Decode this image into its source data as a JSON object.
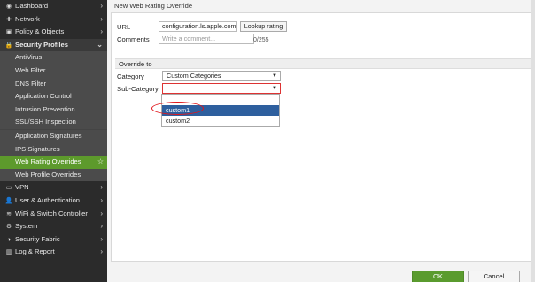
{
  "sidebar": {
    "items": [
      {
        "label": "Dashboard",
        "icon": "dashboard-icon",
        "glyph": "◉",
        "chevron": "›"
      },
      {
        "label": "Network",
        "icon": "network-icon",
        "glyph": "✚",
        "chevron": "›"
      },
      {
        "label": "Policy & Objects",
        "icon": "policy-icon",
        "glyph": "▣",
        "chevron": "›"
      },
      {
        "label": "Security Profiles",
        "icon": "lock-icon",
        "glyph": "🔒",
        "chevron": "⌄"
      }
    ],
    "security_subitems": [
      "AntiVirus",
      "Web Filter",
      "DNS Filter",
      "Application Control",
      "Intrusion Prevention",
      "SSL/SSH Inspection"
    ],
    "signature_items": [
      "Application Signatures",
      "IPS Signatures"
    ],
    "active_item": "Web Rating Overrides",
    "after_active": [
      "Web Profile Overrides"
    ],
    "bottom_items": [
      {
        "label": "VPN",
        "icon": "vpn-icon",
        "glyph": "▭",
        "chevron": "›"
      },
      {
        "label": "User & Authentication",
        "icon": "user-icon",
        "glyph": "👤",
        "chevron": "›"
      },
      {
        "label": "WiFi & Switch Controller",
        "icon": "wifi-icon",
        "glyph": "≋",
        "chevron": "›"
      },
      {
        "label": "System",
        "icon": "gear-icon",
        "glyph": "⚙",
        "chevron": "›"
      },
      {
        "label": "Security Fabric",
        "icon": "fabric-icon",
        "glyph": "◑",
        "chevron": "›"
      },
      {
        "label": "Log & Report",
        "icon": "chart-icon",
        "glyph": "▥",
        "chevron": "›"
      }
    ]
  },
  "panel": {
    "title": "New Web Rating Override",
    "url_label": "URL",
    "url_value": "configuration.ls.apple.com",
    "lookup_button": "Lookup rating",
    "comments_label": "Comments",
    "comments_placeholder": "Write a comment...",
    "comments_counter": "0/255",
    "override_section": "Override to",
    "category_label": "Category",
    "category_value": "Custom Categories",
    "subcategory_label": "Sub-Category",
    "subcategory_value": "",
    "subcategory_options": [
      "",
      "custom1",
      "custom2"
    ],
    "selected_option": "custom1"
  },
  "footer": {
    "ok_label": "OK",
    "cancel_label": "Cancel"
  },
  "colors": {
    "sidebar_bg": "#2b2b2b",
    "active_green": "#5d9a2c",
    "select_blue": "#2e5f9e",
    "annotation_red": "#e0161b"
  }
}
